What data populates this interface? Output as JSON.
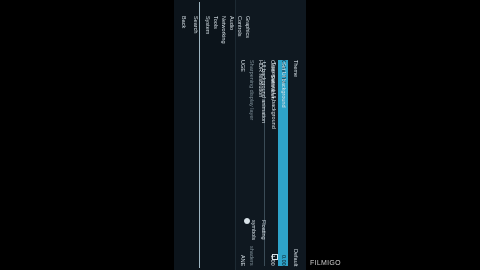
{
  "nav": {
    "items": [
      {
        "label": "Back"
      },
      {
        "label": "Search"
      },
      {
        "label": "System"
      },
      {
        "label": "Tools"
      },
      {
        "label": "Networking"
      },
      {
        "label": "Audio"
      },
      {
        "label": "Controls"
      },
      {
        "label": "Graphics"
      }
    ],
    "selected": "System"
  },
  "panel": {
    "rows": [
      {
        "label": "UGE",
        "value": "ANE"
      },
      {
        "label": "Sharpening display layer",
        "value": "shaders"
      },
      {
        "label": "HDR resolution",
        "value": ""
      },
      {
        "label": "Color Saturation",
        "value": "1.00"
      },
      {
        "label": "Color Tint",
        "value": "0.00"
      },
      {
        "label": "Theme",
        "value": "Default"
      },
      {
        "label": "UI background animation",
        "value": "Floating symbols"
      },
      {
        "label": "Transparent UI background",
        "value": ""
      },
      {
        "label": "Set UI background",
        "value": "…"
      }
    ],
    "selected_index": 4
  },
  "watermark": "FILMIGO",
  "colors": {
    "accent": "#2ea3c9",
    "background": "#0f1820"
  }
}
